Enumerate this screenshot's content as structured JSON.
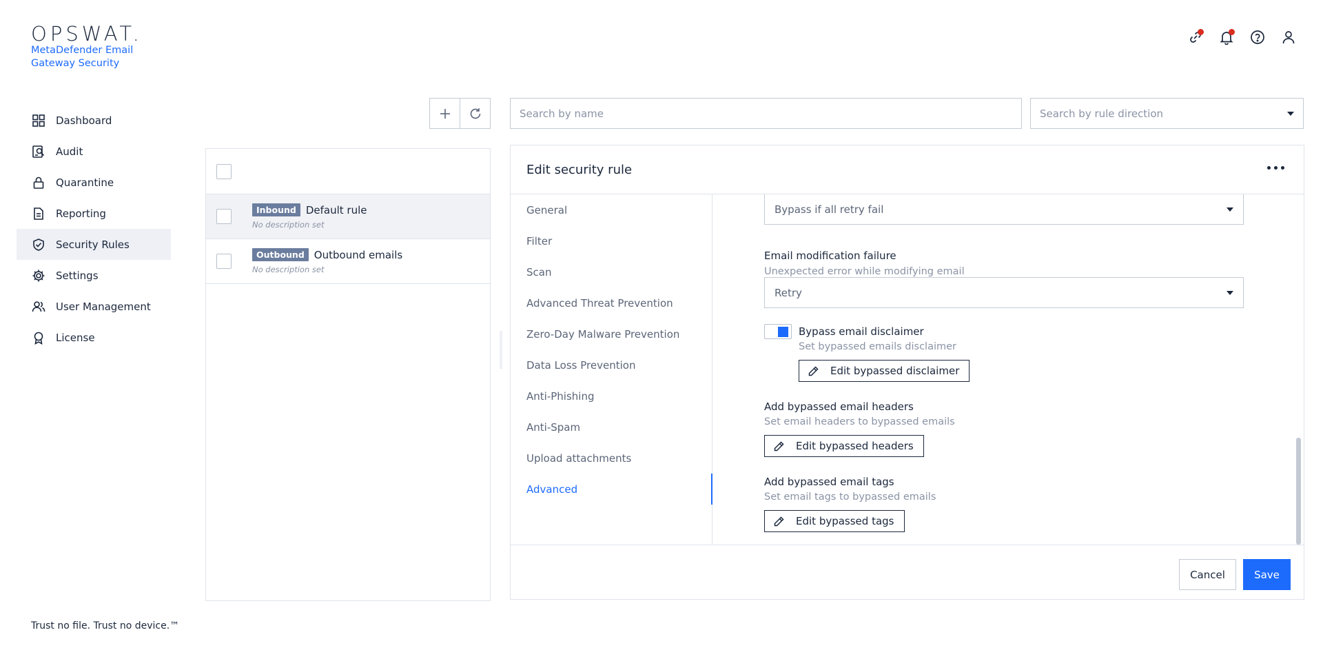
{
  "brand": {
    "logo": "OPSWAT.",
    "product": "MetaDefender Email Gateway Security",
    "tagline": "Trust no file. Trust no device.™"
  },
  "nav": {
    "items": [
      {
        "label": "Dashboard",
        "icon": "dashboard-icon"
      },
      {
        "label": "Audit",
        "icon": "audit-icon"
      },
      {
        "label": "Quarantine",
        "icon": "lock-icon"
      },
      {
        "label": "Reporting",
        "icon": "document-icon"
      },
      {
        "label": "Security Rules",
        "icon": "shield-check-icon",
        "active": true
      },
      {
        "label": "Settings",
        "icon": "gear-icon"
      },
      {
        "label": "User Management",
        "icon": "users-icon"
      },
      {
        "label": "License",
        "icon": "badge-icon"
      }
    ]
  },
  "topbar": {
    "icons": [
      "link-icon",
      "bell-icon",
      "help-icon",
      "user-icon"
    ],
    "notification_color": "#d92d20"
  },
  "toolbar": {
    "add_icon": "plus-icon",
    "refresh_icon": "refresh-icon"
  },
  "search": {
    "name_placeholder": "Search by name",
    "direction_placeholder": "Search by rule direction"
  },
  "rules": [
    {
      "direction": "Inbound",
      "name": "Default rule",
      "description": "No description set",
      "selected": true
    },
    {
      "direction": "Outbound",
      "name": "Outbound emails",
      "description": "No description set",
      "selected": false
    }
  ],
  "edit": {
    "title": "Edit security rule",
    "tabs": [
      "General",
      "Filter",
      "Scan",
      "Advanced Threat Prevention",
      "Zero-Day Malware Prevention",
      "Data Loss Prevention",
      "Anti-Phishing",
      "Anti-Spam",
      "Upload attachments",
      "Advanced"
    ],
    "active_tab": "Advanced",
    "retry_select": "Bypass if all retry fail",
    "modification_failure": {
      "label": "Email modification failure",
      "description": "Unexpected error while modifying email",
      "value": "Retry"
    },
    "disclaimer": {
      "label": "Bypass email disclaimer",
      "description": "Set bypassed emails disclaimer",
      "button": "Edit bypassed disclaimer",
      "enabled": true
    },
    "headers": {
      "label": "Add bypassed email headers",
      "description": "Set email headers to bypassed emails",
      "button": "Edit bypassed headers"
    },
    "tags": {
      "label": "Add bypassed email tags",
      "description": "Set email tags to bypassed emails",
      "button": "Edit bypassed tags"
    },
    "cancel": "Cancel",
    "save": "Save"
  },
  "colors": {
    "accent": "#1d6bfc",
    "badge": "#6b7d9e",
    "text": "#1b273c",
    "muted": "#8a93a5"
  }
}
